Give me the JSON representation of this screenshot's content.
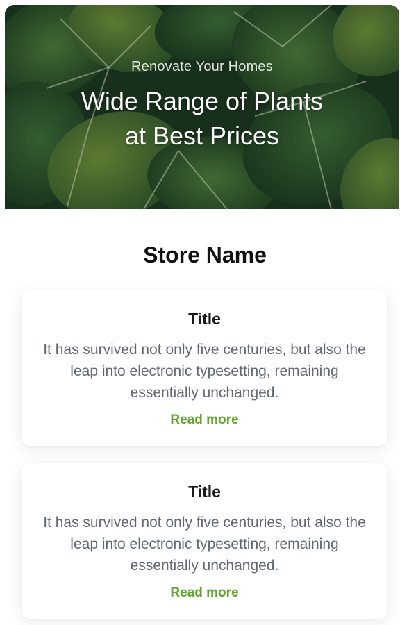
{
  "hero": {
    "eyebrow": "Renovate Your Homes",
    "title_line1": "Wide Range of Plants",
    "title_line2": "at Best Prices",
    "image": "tropical-leaves-photo"
  },
  "store": {
    "name": "Store Name"
  },
  "cards": [
    {
      "title": "Title",
      "body": "It has survived not only five centuries, but also the leap into electronic typesetting, remaining essentially unchanged.",
      "link": "Read more"
    },
    {
      "title": "Title",
      "body": "It has survived not only five centuries, but also the leap into electronic typesetting, remaining essentially unchanged.",
      "link": "Read more"
    }
  ],
  "colors": {
    "accent": "#5fa52a",
    "body_text": "#606876",
    "heading": "#111111",
    "leaf_dark": "#1f3a23",
    "leaf_mid": "#3f6b35"
  }
}
